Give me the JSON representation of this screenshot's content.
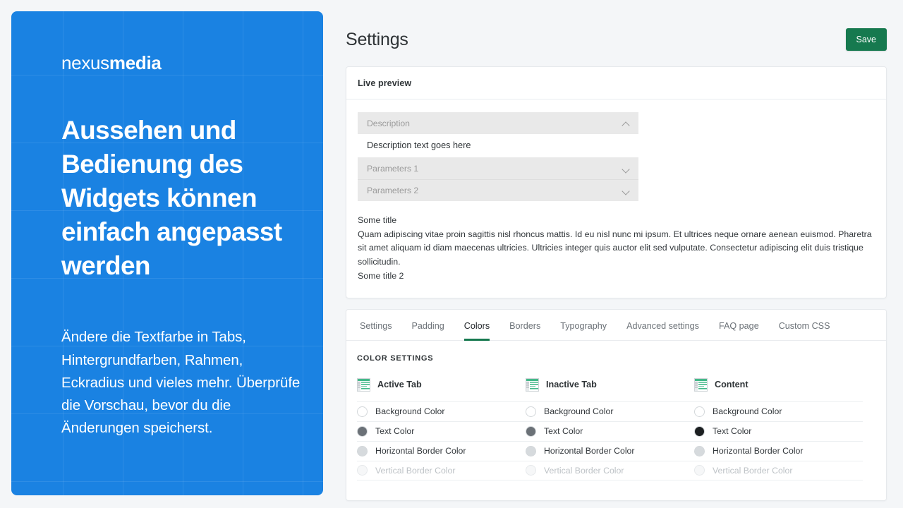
{
  "promo": {
    "brand_light": "nexus",
    "brand_bold": "media",
    "headline": "Aussehen und Bedienung des Widgets können einfach angepasst werden",
    "subtext": "Ändere die Textfarbe in Tabs, Hintergrundfarben, Rahmen, Eckradius und vieles mehr. Überprüfe die Vorschau, bevor du die Änderungen speicherst.",
    "background_color": "#1a82e2"
  },
  "header": {
    "title": "Settings",
    "save_label": "Save",
    "save_color": "#16794f"
  },
  "preview_card": {
    "heading": "Live preview",
    "accordions": [
      {
        "label": "Description",
        "state": "expanded",
        "icon": "chevron-up-icon"
      },
      {
        "label": "Parameters 1",
        "state": "collapsed",
        "icon": "chevron-down-icon"
      },
      {
        "label": "Parameters 2",
        "state": "collapsed",
        "icon": "chevron-down-icon"
      }
    ],
    "description_body": "Description text goes here",
    "body_title_1": "Some title",
    "body_paragraph": "Quam adipiscing vitae proin sagittis nisl rhoncus mattis. Id eu nisl nunc mi ipsum. Et ultrices neque ornare aenean euismod. Pharetra sit amet aliquam id diam maecenas ultricies. Ultricies integer quis auctor elit sed vulputate. Consectetur adipiscing elit duis tristique sollicitudin.",
    "body_title_2": "Some title 2"
  },
  "tabs": [
    {
      "label": "Settings",
      "active": false
    },
    {
      "label": "Padding",
      "active": false
    },
    {
      "label": "Colors",
      "active": true
    },
    {
      "label": "Borders",
      "active": false
    },
    {
      "label": "Typography",
      "active": false
    },
    {
      "label": "Advanced settings",
      "active": false
    },
    {
      "label": "FAQ page",
      "active": false
    },
    {
      "label": "Custom CSS",
      "active": false
    }
  ],
  "colors_panel": {
    "section_label": "COLOR SETTINGS",
    "active_tab_underline_color": "#16794f",
    "columns": [
      {
        "title": "Active Tab",
        "icon": "table-layout-icon",
        "rows": [
          {
            "label": "Background Color",
            "swatch": "#ffffff",
            "disabled": false
          },
          {
            "label": "Text Color",
            "swatch": "#6b7177",
            "disabled": false
          },
          {
            "label": "Horizontal Border Color",
            "swatch": "#d6dadd",
            "disabled": false
          },
          {
            "label": "Vertical Border Color",
            "swatch": "#f2f4f5",
            "disabled": true
          }
        ]
      },
      {
        "title": "Inactive Tab",
        "icon": "table-layout-icon",
        "rows": [
          {
            "label": "Background Color",
            "swatch": "#ffffff",
            "disabled": false
          },
          {
            "label": "Text Color",
            "swatch": "#6b7177",
            "disabled": false
          },
          {
            "label": "Horizontal Border Color",
            "swatch": "#d6dadd",
            "disabled": false
          },
          {
            "label": "Vertical Border Color",
            "swatch": "#f2f4f5",
            "disabled": true
          }
        ]
      },
      {
        "title": "Content",
        "icon": "table-layout-icon",
        "rows": [
          {
            "label": "Background Color",
            "swatch": "#ffffff",
            "disabled": false
          },
          {
            "label": "Text Color",
            "swatch": "#1c1f21",
            "disabled": false
          },
          {
            "label": "Horizontal Border Color",
            "swatch": "#d6dadd",
            "disabled": false
          },
          {
            "label": "Vertical Border Color",
            "swatch": "#f2f4f5",
            "disabled": true
          }
        ]
      }
    ]
  }
}
